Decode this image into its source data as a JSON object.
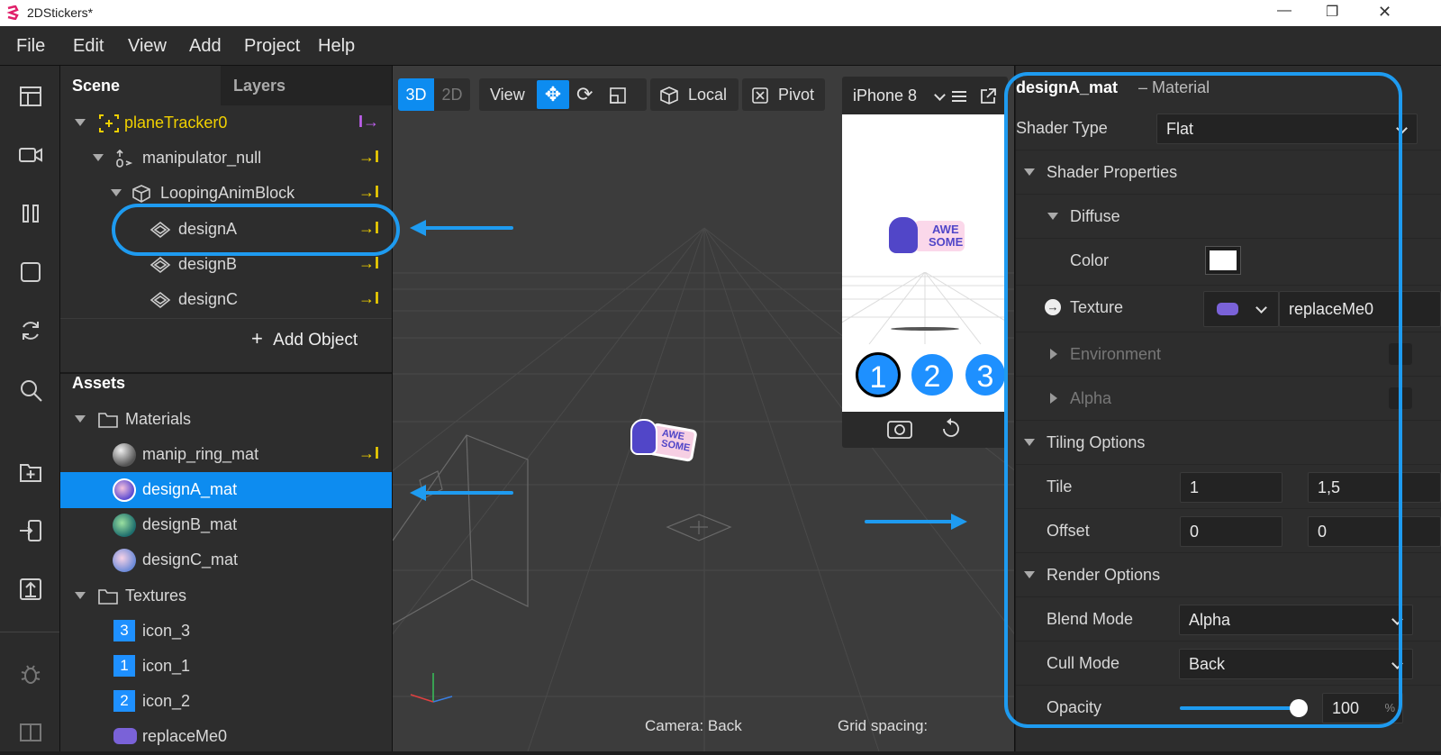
{
  "window": {
    "title": "2DStickers*"
  },
  "menu": [
    "File",
    "Edit",
    "View",
    "Add",
    "Project",
    "Help"
  ],
  "scene_panel": {
    "tabs": [
      "Scene",
      "Layers"
    ],
    "items": [
      {
        "label": "planeTracker0"
      },
      {
        "label": "manipulator_null"
      },
      {
        "label": "LoopingAnimBlock"
      },
      {
        "label": "designA"
      },
      {
        "label": "designB"
      },
      {
        "label": "designC"
      }
    ],
    "add_object": "Add Object"
  },
  "assets": {
    "title": "Assets",
    "materials_folder": "Materials",
    "materials": [
      "manip_ring_mat",
      "designA_mat",
      "designB_mat",
      "designC_mat"
    ],
    "textures_folder": "Textures",
    "textures": [
      {
        "num": "3",
        "label": "icon_3"
      },
      {
        "num": "1",
        "label": "icon_1"
      },
      {
        "num": "2",
        "label": "icon_2"
      },
      {
        "num": "",
        "label": "replaceMe0"
      }
    ]
  },
  "viewport": {
    "mode_3d": "3D",
    "mode_2d": "2D",
    "view_label": "View",
    "local_label": "Local",
    "pivot_label": "Pivot",
    "device": "iPhone 8",
    "camera_status": "Camera: Back",
    "grid_status": "Grid spacing:",
    "sticker_text": [
      "AWE",
      "SOME"
    ],
    "phone_buttons": [
      "1",
      "2",
      "3"
    ]
  },
  "inspector": {
    "name": "designA_mat",
    "type": "– Material",
    "shader_type_label": "Shader Type",
    "shader_type_value": "Flat",
    "shader_properties": "Shader Properties",
    "diffuse": "Diffuse",
    "color_label": "Color",
    "texture_label": "Texture",
    "texture_value": "replaceMe0",
    "environment": "Environment",
    "alpha": "Alpha",
    "tiling_options": "Tiling Options",
    "tile_label": "Tile",
    "tile_x": "1",
    "tile_y": "1,5",
    "offset_label": "Offset",
    "offset_x": "0",
    "offset_y": "0",
    "render_options": "Render Options",
    "blend_mode_label": "Blend Mode",
    "blend_mode_value": "Alpha",
    "cull_mode_label": "Cull Mode",
    "cull_mode_value": "Back",
    "opacity_label": "Opacity",
    "opacity_value": "100",
    "opacity_unit": "%",
    "opacity_level": 1.0
  },
  "colors": {
    "accent": "#1e9bf0",
    "selection": "#0d8cf0",
    "link_arrow": "#f0d000",
    "tracker_arrow": "#d070ff"
  }
}
